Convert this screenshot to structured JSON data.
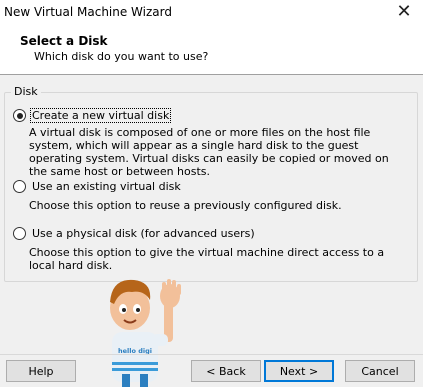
{
  "window": {
    "title": "New Virtual Machine Wizard",
    "close_glyph": "✕"
  },
  "header": {
    "title": "Select a Disk",
    "subtitle": "Which disk do you want to use?"
  },
  "disk_group": {
    "label": "Disk",
    "options": [
      {
        "label": "Create a new virtual disk",
        "selected": true,
        "description": "A virtual disk is composed of one or more files on the host file system, which will appear as a single hard disk to the guest operating system. Virtual disks can easily be copied or moved on the same host or between hosts."
      },
      {
        "label": "Use an existing virtual disk",
        "selected": false,
        "description": "Choose this option to reuse a previously configured disk."
      },
      {
        "label": "Use a physical disk (for advanced users)",
        "selected": false,
        "description": "Choose this option to give the virtual machine direct access to a local hard disk."
      }
    ]
  },
  "mascot": {
    "shirt_text": "hello digi"
  },
  "buttons": {
    "help": "Help",
    "back": "< Back",
    "next": "Next >",
    "cancel": "Cancel"
  },
  "colors": {
    "accent": "#0078d7",
    "background": "#f0f0f0",
    "header_bg": "#ffffff"
  }
}
